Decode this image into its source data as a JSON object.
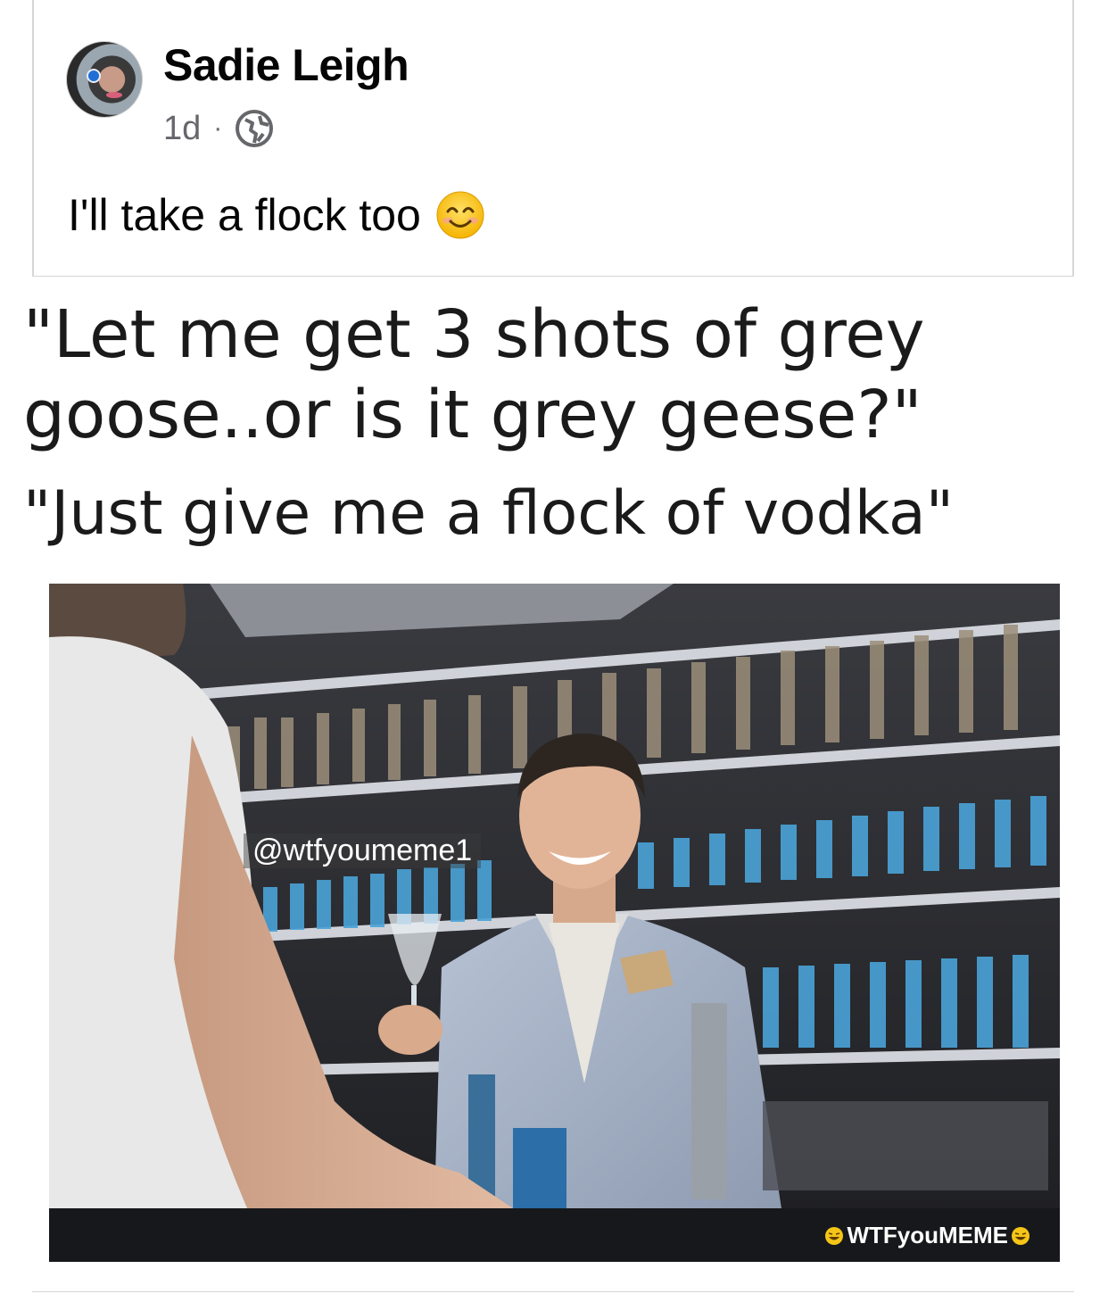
{
  "post": {
    "author": "Sadie Leigh",
    "time": "1d",
    "separator": "·",
    "privacy_icon": "globe-icon",
    "comment_text": "I'll take a flock too",
    "comment_emoji": "smiling-face-icon"
  },
  "meme": {
    "caption_line1": "\"Let me get 3 shots of grey",
    "caption_line2": "goose..or is it grey geese?\"",
    "caption_line3": "\"Just give me a flock of vodka\"",
    "watermark_top": "@wtfyoumeme1",
    "watermark_bottom": "WTFyouMEME"
  },
  "colors": {
    "name_text": "#050505",
    "meta_text": "#65676b",
    "bottle_blue": "#4aa3d8"
  }
}
